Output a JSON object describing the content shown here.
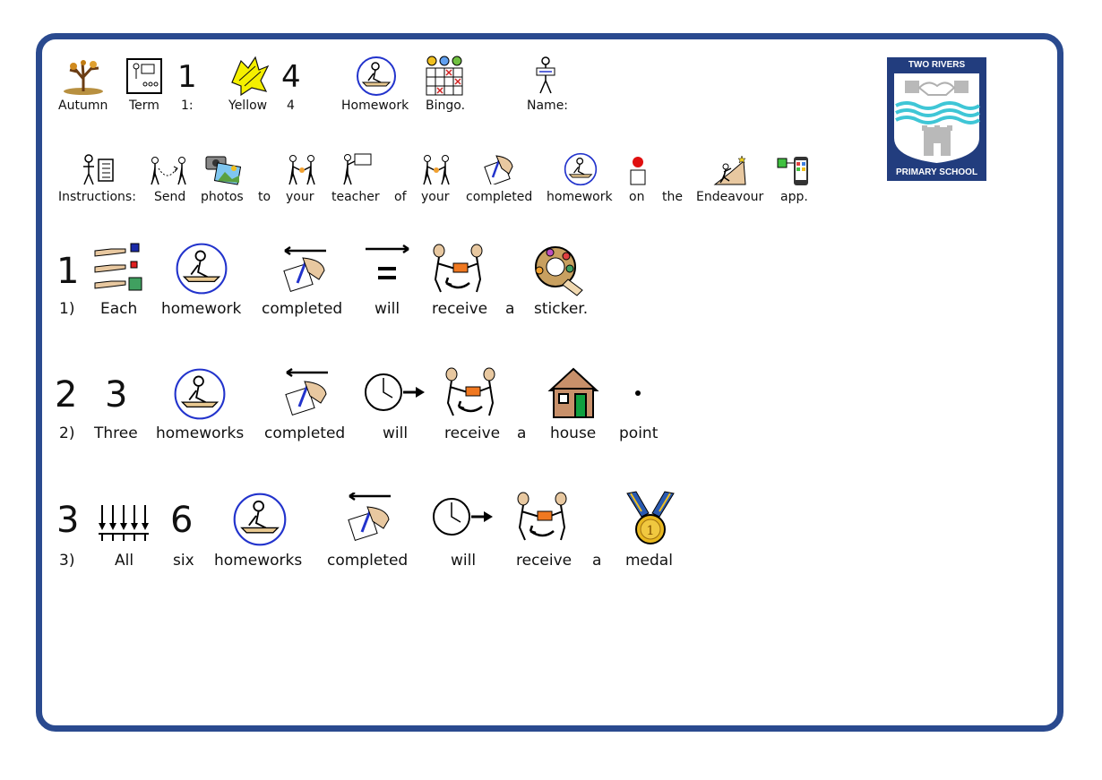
{
  "row1": {
    "labels": [
      "Autumn",
      "Term",
      "1:",
      "Yellow",
      "4",
      "Homework",
      "Bingo.",
      "Name:"
    ],
    "numbers": [
      "1",
      "4"
    ]
  },
  "instructions": {
    "labels": [
      "Instructions:",
      "Send",
      "photos",
      "to",
      "your",
      "teacher",
      "of",
      "your",
      "completed",
      "homework",
      "on",
      "the",
      "Endeavour",
      "app."
    ]
  },
  "rule1": {
    "number": "1",
    "labels": [
      "1)",
      "Each",
      "homework",
      "completed",
      "will",
      "receive",
      "a",
      "sticker."
    ]
  },
  "rule2": {
    "numbers": [
      "2",
      "3"
    ],
    "labels": [
      "2)",
      "Three",
      "homeworks",
      "completed",
      "will",
      "receive",
      "a",
      "house",
      "point"
    ]
  },
  "rule3": {
    "numbers": [
      "3",
      "6"
    ],
    "labels": [
      "3)",
      "All",
      "six",
      "homeworks",
      "completed",
      "will",
      "receive",
      "a",
      "medal"
    ]
  },
  "logo": {
    "top_text": "TWO RIVERS",
    "bottom_text": "PRIMARY SCHOOL",
    "colors": {
      "shield": "#223d7e",
      "water": "#3fc6d6",
      "stone": "#b9b9b9"
    }
  },
  "colors": {
    "frame": "#2a4a8f",
    "circle": "#2233cc",
    "yellow": "#f5f000"
  }
}
